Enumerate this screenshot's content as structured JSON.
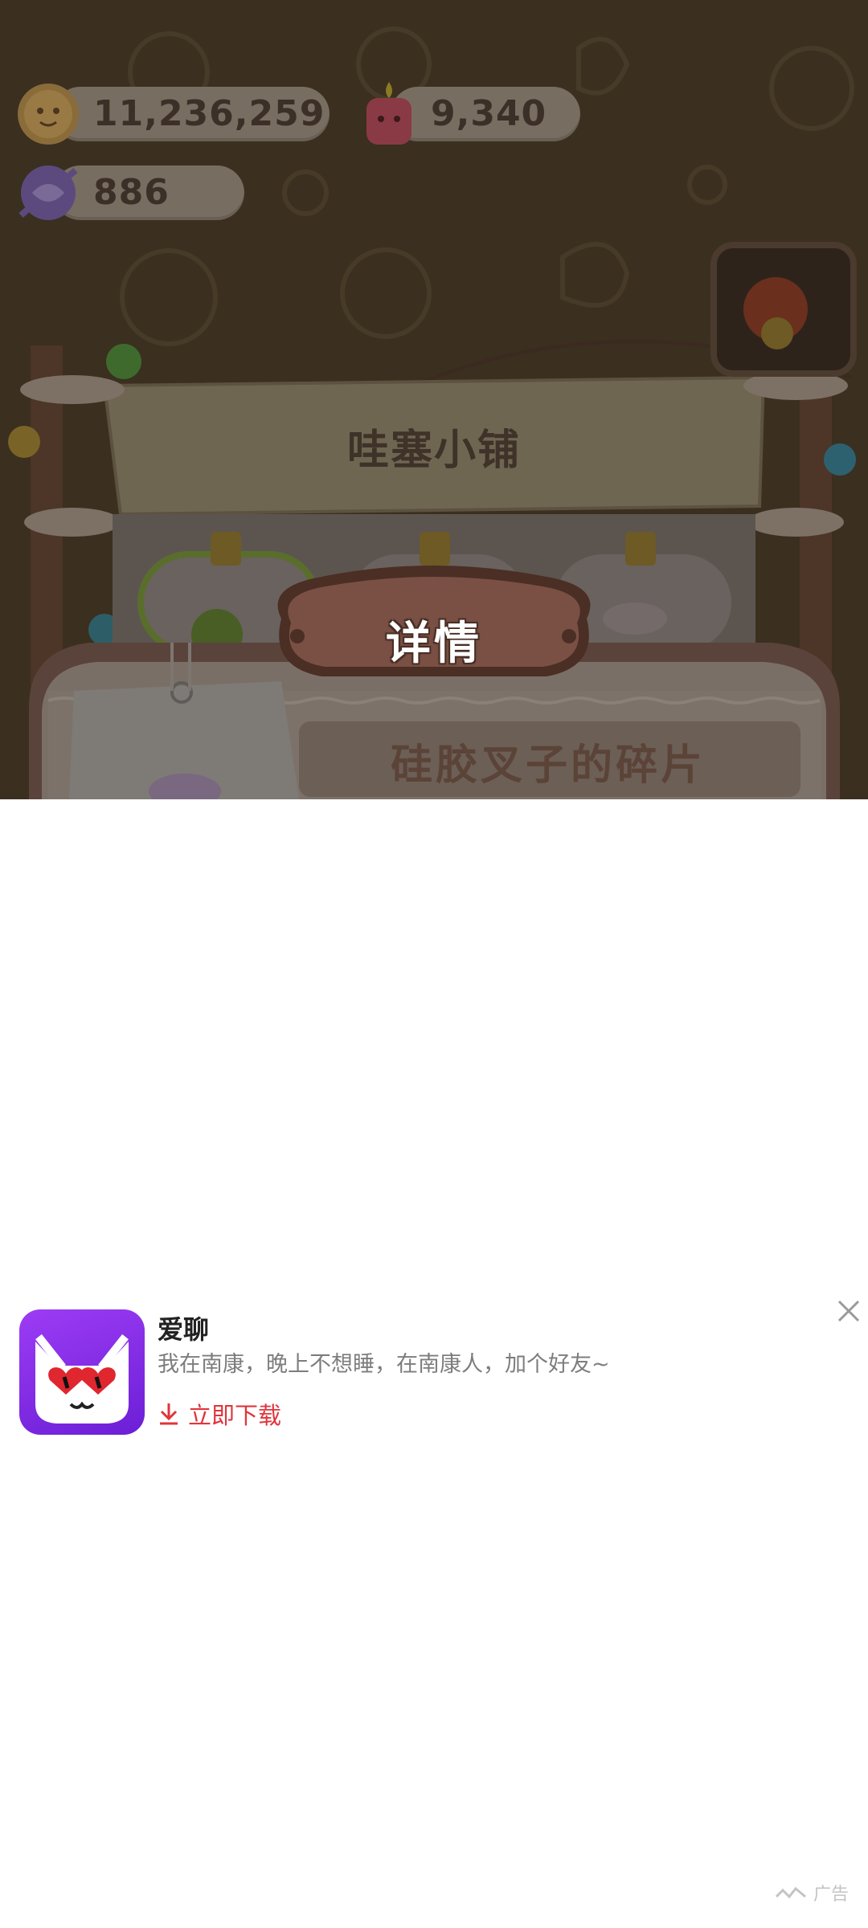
{
  "game": {
    "resources": {
      "coins": "11,236,259",
      "candles": "9,340",
      "candy": "886"
    },
    "shop_title": "哇塞小铺",
    "dialog_title": "详情",
    "item_name": "硅胶叉子的碎片"
  },
  "ad": {
    "app_name": "爱聊",
    "description": "我在南康，晚上不想睡，在南康人，加个好友~",
    "download_label": "立即下载",
    "ad_label": "广告",
    "colors": {
      "accent": "#e0353b",
      "icon_bg": "#8a2ff0"
    }
  },
  "icons": [
    "cookie-coin-icon",
    "candle-icon",
    "candy-icon",
    "close-icon",
    "download-arrow-icon",
    "cat-hearts-icon",
    "ad-brand-icon"
  ]
}
